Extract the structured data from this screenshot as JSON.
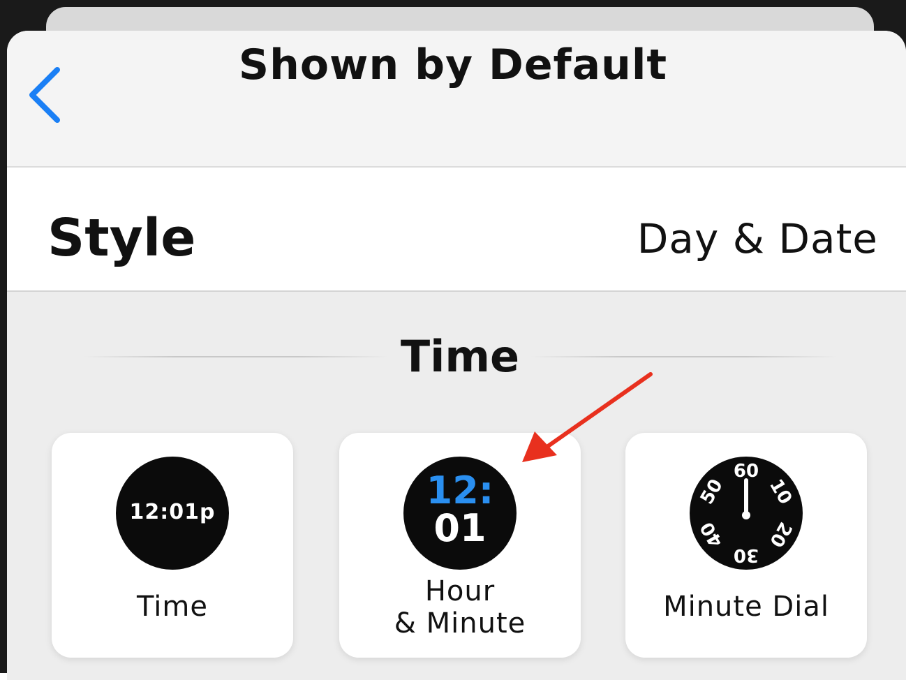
{
  "header": {
    "title": "Shown by Default",
    "back_icon": "chevron-left-icon"
  },
  "style_row": {
    "label": "Style",
    "value": "Day & Date"
  },
  "section": {
    "title": "Time"
  },
  "options": [
    {
      "label": "Time",
      "preview_text": "12:01p"
    },
    {
      "label_line1": "Hour",
      "label_line2": "& Minute",
      "preview_hour": "12:",
      "preview_minute": "01"
    },
    {
      "label": "Minute Dial",
      "dial_numbers": [
        "60",
        "10",
        "20",
        "30",
        "40",
        "50"
      ]
    }
  ],
  "colors": {
    "accent_blue": "#1a7ff5",
    "hour_blue": "#2a8ff0",
    "annotation_arrow": "#e8301e"
  }
}
